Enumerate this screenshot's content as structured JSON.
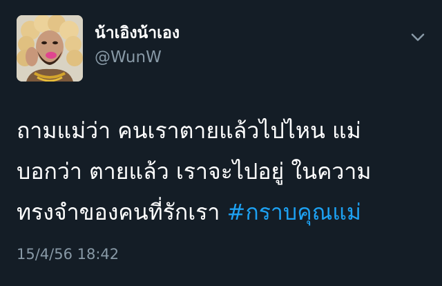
{
  "tweet": {
    "display_name": "น้าเอิงน้าเอง",
    "handle": "@WunW",
    "text_lines": [
      "ถามแม่ว่า คนเราตายแล้วไปไหน แม่",
      "บอกว่า ตายแล้ว เราจะไปอยู่ ในความ",
      "ทรงจำของคนที่รักเรา "
    ],
    "hashtag": "#กราบคุณแม่",
    "timestamp": "15/4/56 18:42",
    "more_icon": "chevron-down-icon"
  },
  "colors": {
    "background": "#141d26",
    "text": "#ffffff",
    "muted": "#8899a6",
    "link": "#1da1f2"
  }
}
